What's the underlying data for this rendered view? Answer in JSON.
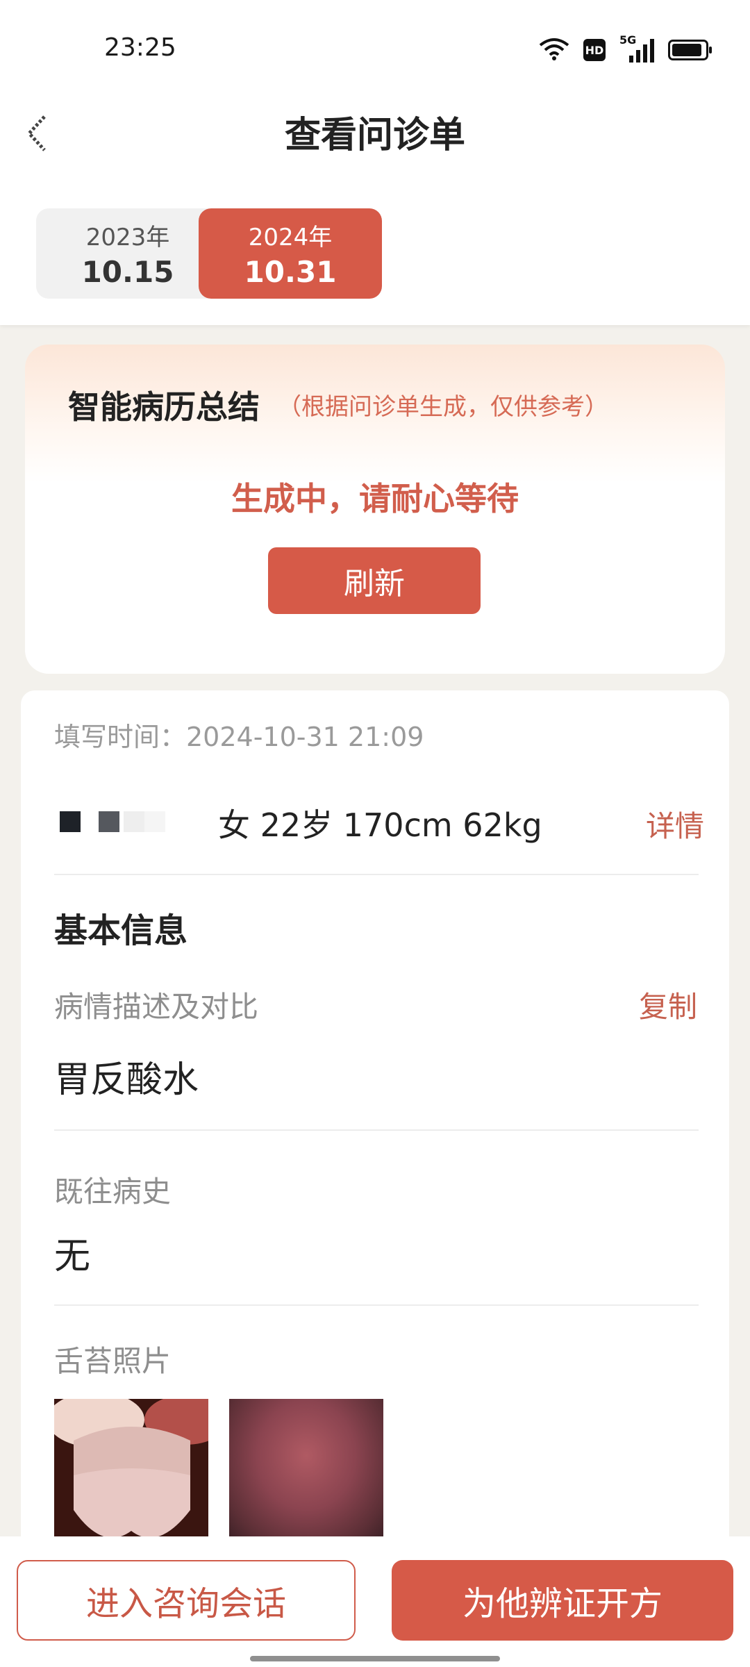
{
  "status_bar": {
    "time": "23:25",
    "network_badge": "HD",
    "signal_label": "5G",
    "icons": [
      "wifi-icon",
      "hd-icon",
      "signal-icon",
      "battery-icon"
    ]
  },
  "header": {
    "title": "查看问诊单",
    "back_icon": "back-arrow-icon"
  },
  "date_tabs": [
    {
      "year": "2023年",
      "date": "10.15",
      "active": false
    },
    {
      "year": "2024年",
      "date": "10.31",
      "active": true
    }
  ],
  "summary": {
    "title": "智能病历总结",
    "hint": "（根据问诊单生成，仅供参考）",
    "status": "生成中，请耐心等待",
    "refresh_label": "刷新"
  },
  "form": {
    "fill_time_label": "填写时间：",
    "fill_time_value": "2024-10-31 21:09",
    "fill_time": "填写时间：2024-10-31 21:09",
    "patient": {
      "gender": "女",
      "age": "22岁",
      "height": "170cm",
      "weight": "62kg",
      "summary": "女 22岁 170cm 62kg",
      "detail_label": "详情"
    },
    "section_title": "基本信息",
    "condition": {
      "label": "病情描述及对比",
      "copy_label": "复制",
      "value": "胃反酸水"
    },
    "history": {
      "label": "既往病史",
      "value": "无"
    },
    "tongue": {
      "label": "舌苔照片",
      "photos": [
        "tongue-photo-1",
        "tongue-photo-2"
      ]
    }
  },
  "actions": {
    "consult_label": "进入咨询会话",
    "prescribe_label": "为他辨证开方"
  },
  "colors": {
    "accent": "#d65a48",
    "accent_text": "#c6614f",
    "background": "#f3f1ec"
  }
}
